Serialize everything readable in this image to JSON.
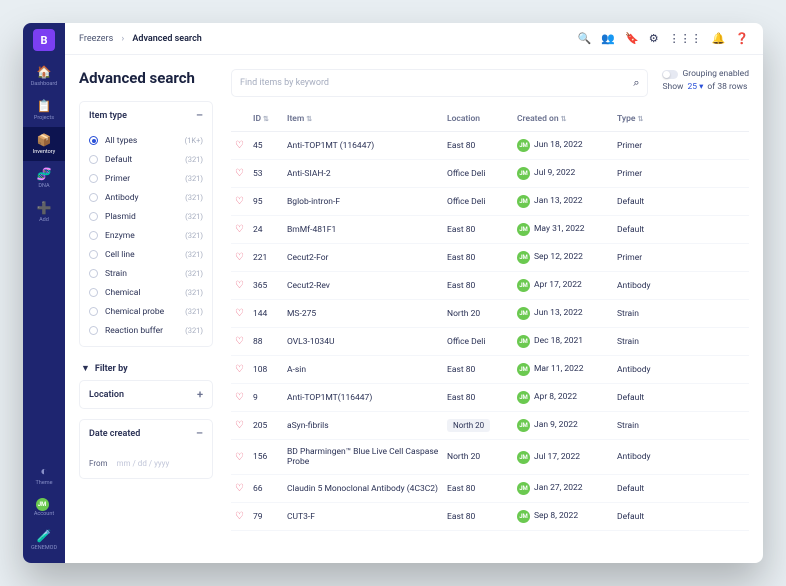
{
  "logo": "B",
  "nav": [
    {
      "icon": "🏠",
      "label": "Dashboard"
    },
    {
      "icon": "📋",
      "label": "Projects"
    },
    {
      "icon": "📦",
      "label": "Inventory",
      "active": true
    },
    {
      "icon": "🧬",
      "label": "DNA"
    },
    {
      "icon": "➕",
      "label": "Add"
    }
  ],
  "navBottom": [
    {
      "icon": "◐",
      "label": "Theme"
    },
    {
      "icon": "JM",
      "label": "Account",
      "avatar": true
    },
    {
      "icon": "🧪",
      "label": "GENEMOD"
    }
  ],
  "breadcrumb": {
    "root": "Freezers",
    "sep": "›",
    "current": "Advanced search"
  },
  "topIcons": [
    "🔍",
    "👥",
    "🔖",
    "⚙",
    "⋮⋮⋮",
    "🔔",
    "❓"
  ],
  "pageTitle": "Advanced search",
  "itemTypePanel": {
    "title": "Item type",
    "toggle": "–"
  },
  "types": [
    {
      "label": "All types",
      "count": "(1K+)",
      "sel": true
    },
    {
      "label": "Default",
      "count": "(321)"
    },
    {
      "label": "Primer",
      "count": "(321)"
    },
    {
      "label": "Antibody",
      "count": "(321)"
    },
    {
      "label": "Plasmid",
      "count": "(321)"
    },
    {
      "label": "Enzyme",
      "count": "(321)"
    },
    {
      "label": "Cell line",
      "count": "(321)"
    },
    {
      "label": "Strain",
      "count": "(321)"
    },
    {
      "label": "Chemical",
      "count": "(321)"
    },
    {
      "label": "Chemical probe",
      "count": "(321)"
    },
    {
      "label": "Reaction buffer",
      "count": "(321)"
    }
  ],
  "filterBy": "Filter by",
  "locationPanel": {
    "title": "Location",
    "toggle": "+"
  },
  "datePanel": {
    "title": "Date created",
    "toggle": "–"
  },
  "dateFrom": {
    "label": "From",
    "placeholder": "mm / dd / yyyy"
  },
  "search": {
    "placeholder": "Find items by keyword"
  },
  "grouping": "Grouping enabled",
  "showRow": {
    "pre": "Show",
    "count": "25",
    "chev": "▾",
    "post": "of 38 rows"
  },
  "columns": [
    "",
    "ID",
    "Item",
    "Location",
    "Created on",
    "Type"
  ],
  "rows": [
    {
      "id": "45",
      "item": "Anti-TOP1MT (116447)",
      "loc": "East 80",
      "date": "Jun 18, 2022",
      "type": "Primer"
    },
    {
      "id": "53",
      "item": "Anti-SIAH-2",
      "loc": "Office Deli",
      "date": "Jul 9, 2022",
      "type": "Primer"
    },
    {
      "id": "95",
      "item": "Bglob-intron-F",
      "loc": "Office Deli",
      "date": "Jan 13, 2022",
      "type": "Default"
    },
    {
      "id": "24",
      "item": "BmMf-481F1",
      "loc": "East 80",
      "date": "May 31, 2022",
      "type": "Default"
    },
    {
      "id": "221",
      "item": "Cecut2-For",
      "loc": "East 80",
      "date": "Sep 12, 2022",
      "type": "Primer"
    },
    {
      "id": "365",
      "item": "Cecut2-Rev",
      "loc": "East 80",
      "date": "Apr 17, 2022",
      "type": "Antibody"
    },
    {
      "id": "144",
      "item": "MS-275",
      "loc": "North 20",
      "date": "Jun 13, 2022",
      "type": "Strain"
    },
    {
      "id": "88",
      "item": "OVL3-1034U",
      "loc": "Office Deli",
      "date": "Dec 18, 2021",
      "type": "Strain"
    },
    {
      "id": "108",
      "item": "A-sin",
      "loc": "East 80",
      "date": "Mar 11, 2022",
      "type": "Antibody"
    },
    {
      "id": "9",
      "item": "Anti-TOP1MT(116447)",
      "loc": "East 80",
      "date": "Apr 8, 2022",
      "type": "Default"
    },
    {
      "id": "205",
      "item": "aSyn-fibrils",
      "loc": "North 20",
      "chip": true,
      "date": "Jan 9, 2022",
      "type": "Strain"
    },
    {
      "id": "156",
      "item": "BD Pharmingen™ Blue Live Cell Caspase Probe",
      "loc": "North 20",
      "date": "Jul 17, 2022",
      "type": "Antibody"
    },
    {
      "id": "66",
      "item": "Claudin 5 Monoclonal Antibody (4C3C2)",
      "loc": "East 80",
      "date": "Jan 27, 2022",
      "type": "Default"
    },
    {
      "id": "79",
      "item": "CUT3-F",
      "loc": "East 80",
      "date": "Sep 8, 2022",
      "type": "Default"
    }
  ],
  "avatar": "JM"
}
